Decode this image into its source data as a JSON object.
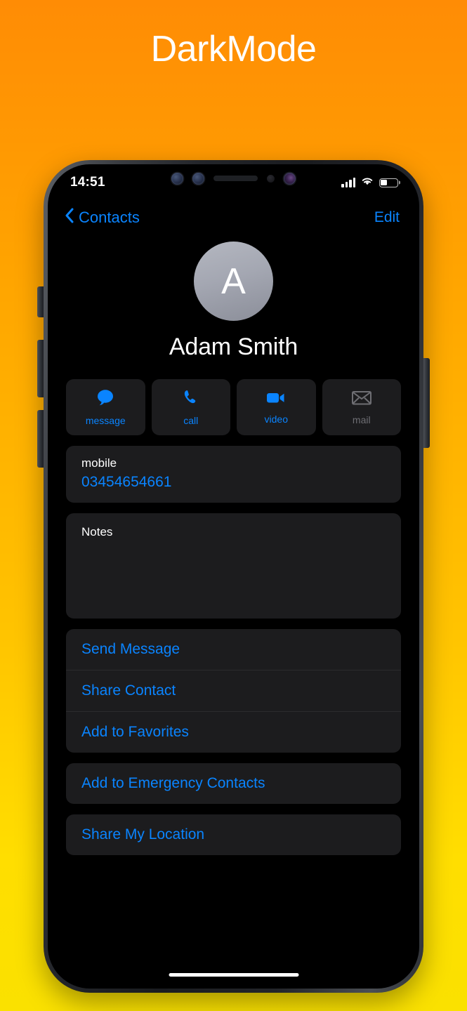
{
  "page": {
    "title": "DarkMode",
    "background_gradient_from": "#FF8C05",
    "background_gradient_to": "#FAE100"
  },
  "phone": {
    "status_bar": {
      "time": "14:51",
      "signal_icon": "signal-bars-icon",
      "wifi_icon": "wifi-icon",
      "battery_icon": "battery-icon",
      "battery_level_percent": 40
    },
    "notch": {
      "sensor_left_icon": "face-id-sensor-icon",
      "sensor_mid_icon": "infrared-camera-icon",
      "speaker_icon": "earpiece-speaker-icon",
      "ambient_icon": "ambient-light-sensor-icon",
      "camera_icon": "front-camera-icon"
    },
    "side_buttons": {
      "silent_switch": "silent-switch",
      "volume_up": "volume-up-button",
      "volume_down": "volume-down-button",
      "power": "power-button"
    },
    "home_indicator": "home-indicator"
  },
  "nav": {
    "back_label": "Contacts",
    "back_icon": "chevron-left-icon",
    "edit_label": "Edit",
    "accent_color": "#0A84FF"
  },
  "contact": {
    "avatar_initial": "A",
    "name": "Adam Smith"
  },
  "actions": [
    {
      "label": "message",
      "icon": "message-bubble-icon",
      "disabled": false
    },
    {
      "label": "call",
      "icon": "phone-icon",
      "disabled": false
    },
    {
      "label": "video",
      "icon": "video-camera-icon",
      "disabled": false
    },
    {
      "label": "mail",
      "icon": "envelope-icon",
      "disabled": true
    }
  ],
  "phone_field": {
    "label": "mobile",
    "value": "03454654661"
  },
  "notes": {
    "label": "Notes",
    "value": ""
  },
  "list_group_1": [
    {
      "label": "Send Message"
    },
    {
      "label": "Share Contact"
    },
    {
      "label": "Add to Favorites"
    }
  ],
  "list_group_2": [
    {
      "label": "Add to Emergency Contacts"
    }
  ],
  "list_group_3": [
    {
      "label": "Share My Location"
    }
  ],
  "colors": {
    "card_bg": "#1C1C1E",
    "screen_bg": "#000000",
    "accent": "#0A84FF",
    "disabled": "#6E6E73",
    "separator": "#2C2C2E"
  }
}
